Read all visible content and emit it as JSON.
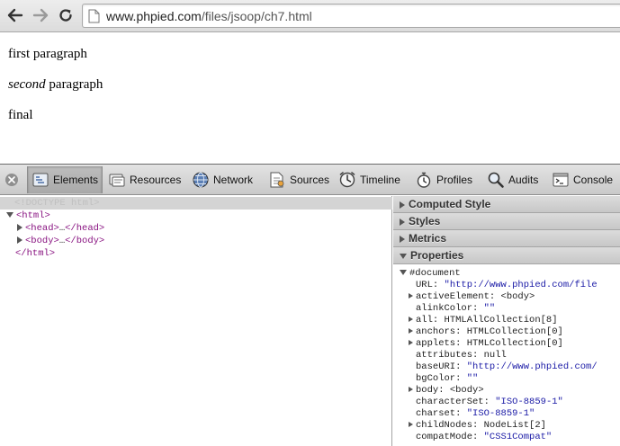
{
  "browser": {
    "url_host": "www.phpied.com",
    "url_path": "/files/jsoop/ch7.html"
  },
  "page": {
    "p1": "first paragraph",
    "p2_em": "second",
    "p2_rest": " paragraph",
    "p3": "final"
  },
  "devtools": {
    "tabs": [
      "Elements",
      "Resources",
      "Network",
      "Sources",
      "Timeline",
      "Profiles",
      "Audits",
      "Console"
    ],
    "selected_tab": "Elements",
    "dom": {
      "doctype": "<!DOCTYPE html>",
      "html_open": "<html>",
      "head_open": "<head>",
      "head_close": "</head>",
      "body_open": "<body>",
      "body_close": "</body>",
      "html_close": "</html>",
      "ellipsis": "…"
    },
    "sidebar": {
      "sections": [
        "Computed Style",
        "Styles",
        "Metrics",
        "Properties"
      ],
      "root": "#document",
      "properties": [
        {
          "name": "URL",
          "sep": ": ",
          "value": "\"http://www.phpied.com/file",
          "kind": "str",
          "expandable": false
        },
        {
          "name": "activeElement",
          "sep": ": ",
          "value": "<body>",
          "kind": "val",
          "expandable": true
        },
        {
          "name": "alinkColor",
          "sep": ": ",
          "value": "\"\"",
          "kind": "str",
          "expandable": false
        },
        {
          "name": "all",
          "sep": ": ",
          "value": "HTMLAllCollection[8]",
          "kind": "val",
          "expandable": true
        },
        {
          "name": "anchors",
          "sep": ": ",
          "value": "HTMLCollection[0]",
          "kind": "val",
          "expandable": true
        },
        {
          "name": "applets",
          "sep": ": ",
          "value": "HTMLCollection[0]",
          "kind": "val",
          "expandable": true
        },
        {
          "name": "attributes",
          "sep": ": ",
          "value": "null",
          "kind": "val",
          "expandable": false
        },
        {
          "name": "baseURI",
          "sep": ": ",
          "value": "\"http://www.phpied.com/",
          "kind": "str",
          "expandable": false
        },
        {
          "name": "bgColor",
          "sep": ": ",
          "value": "\"\"",
          "kind": "str",
          "expandable": false
        },
        {
          "name": "body",
          "sep": ": ",
          "value": "<body>",
          "kind": "val",
          "expandable": true
        },
        {
          "name": "characterSet",
          "sep": ": ",
          "value": "\"ISO-8859-1\"",
          "kind": "str",
          "expandable": false
        },
        {
          "name": "charset",
          "sep": ": ",
          "value": "\"ISO-8859-1\"",
          "kind": "str",
          "expandable": false
        },
        {
          "name": "childNodes",
          "sep": ": ",
          "value": "NodeList[2]",
          "kind": "val",
          "expandable": true
        },
        {
          "name": "compatMode",
          "sep": ": ",
          "value": "\"CSS1Compat\"",
          "kind": "str",
          "expandable": false
        }
      ]
    }
  }
}
